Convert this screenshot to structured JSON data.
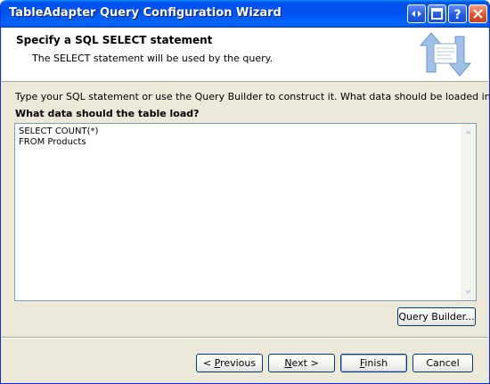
{
  "window": {
    "title": "TableAdapter Query Configuration Wizard"
  },
  "header": {
    "title": "Specify a SQL SELECT statement",
    "subtitle": "The SELECT statement will be used by the query."
  },
  "body": {
    "instruction": "Type your SQL statement or use the Query Builder to construct it. What data should be loaded into the table?",
    "question_label": "What data should the table load?",
    "sql_text": "SELECT COUNT(*)\nFROM Products"
  },
  "buttons": {
    "query_builder": "Query Builder...",
    "previous_prefix": "< ",
    "previous_key": "P",
    "previous_rest": "revious",
    "next_key": "N",
    "next_rest": "ext >",
    "finish_key": "F",
    "finish_rest": "inish",
    "cancel": "Cancel"
  },
  "icons": [
    "help-arrows-icon",
    "restore-icon",
    "help-icon",
    "close-icon",
    "wizard-arrows-icon",
    "scroll-up-icon",
    "scroll-down-icon"
  ]
}
